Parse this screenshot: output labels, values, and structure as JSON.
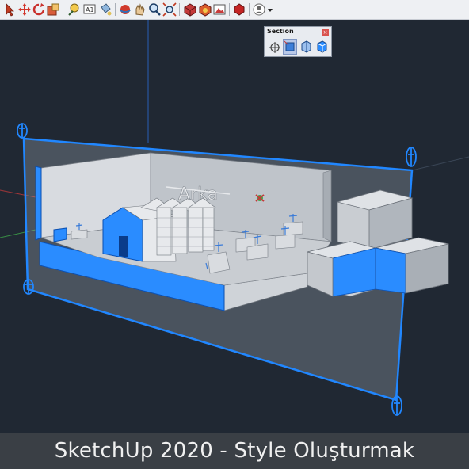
{
  "toolbar": {
    "icons": [
      "select-icon",
      "move-icon",
      "rotate-icon",
      "scale-icon",
      "tape-measure-icon",
      "text-icon",
      "paint-bucket-icon",
      "orbit-icon",
      "pan-icon",
      "zoom-icon",
      "zoom-extents-icon",
      "components-icon",
      "warehouse-icon",
      "materials-icon",
      "extension-icon",
      "account-icon"
    ],
    "dropdown_icon": "chevron-down-icon"
  },
  "section_panel": {
    "title": "Section",
    "close_icon": "close-icon",
    "tools": [
      {
        "name": "section-plane-tool",
        "active": false
      },
      {
        "name": "display-section-planes-tool",
        "active": true
      },
      {
        "name": "display-section-cuts-tool",
        "active": false
      },
      {
        "name": "display-section-fill-tool",
        "active": false
      }
    ]
  },
  "model": {
    "sign_text": "Arka"
  },
  "colors": {
    "viewport_bg": "#202833",
    "section_plane": "#1f78ff",
    "accent_blue": "#1e88ff"
  },
  "caption": "SketchUp 2020 - Style Oluşturmak"
}
